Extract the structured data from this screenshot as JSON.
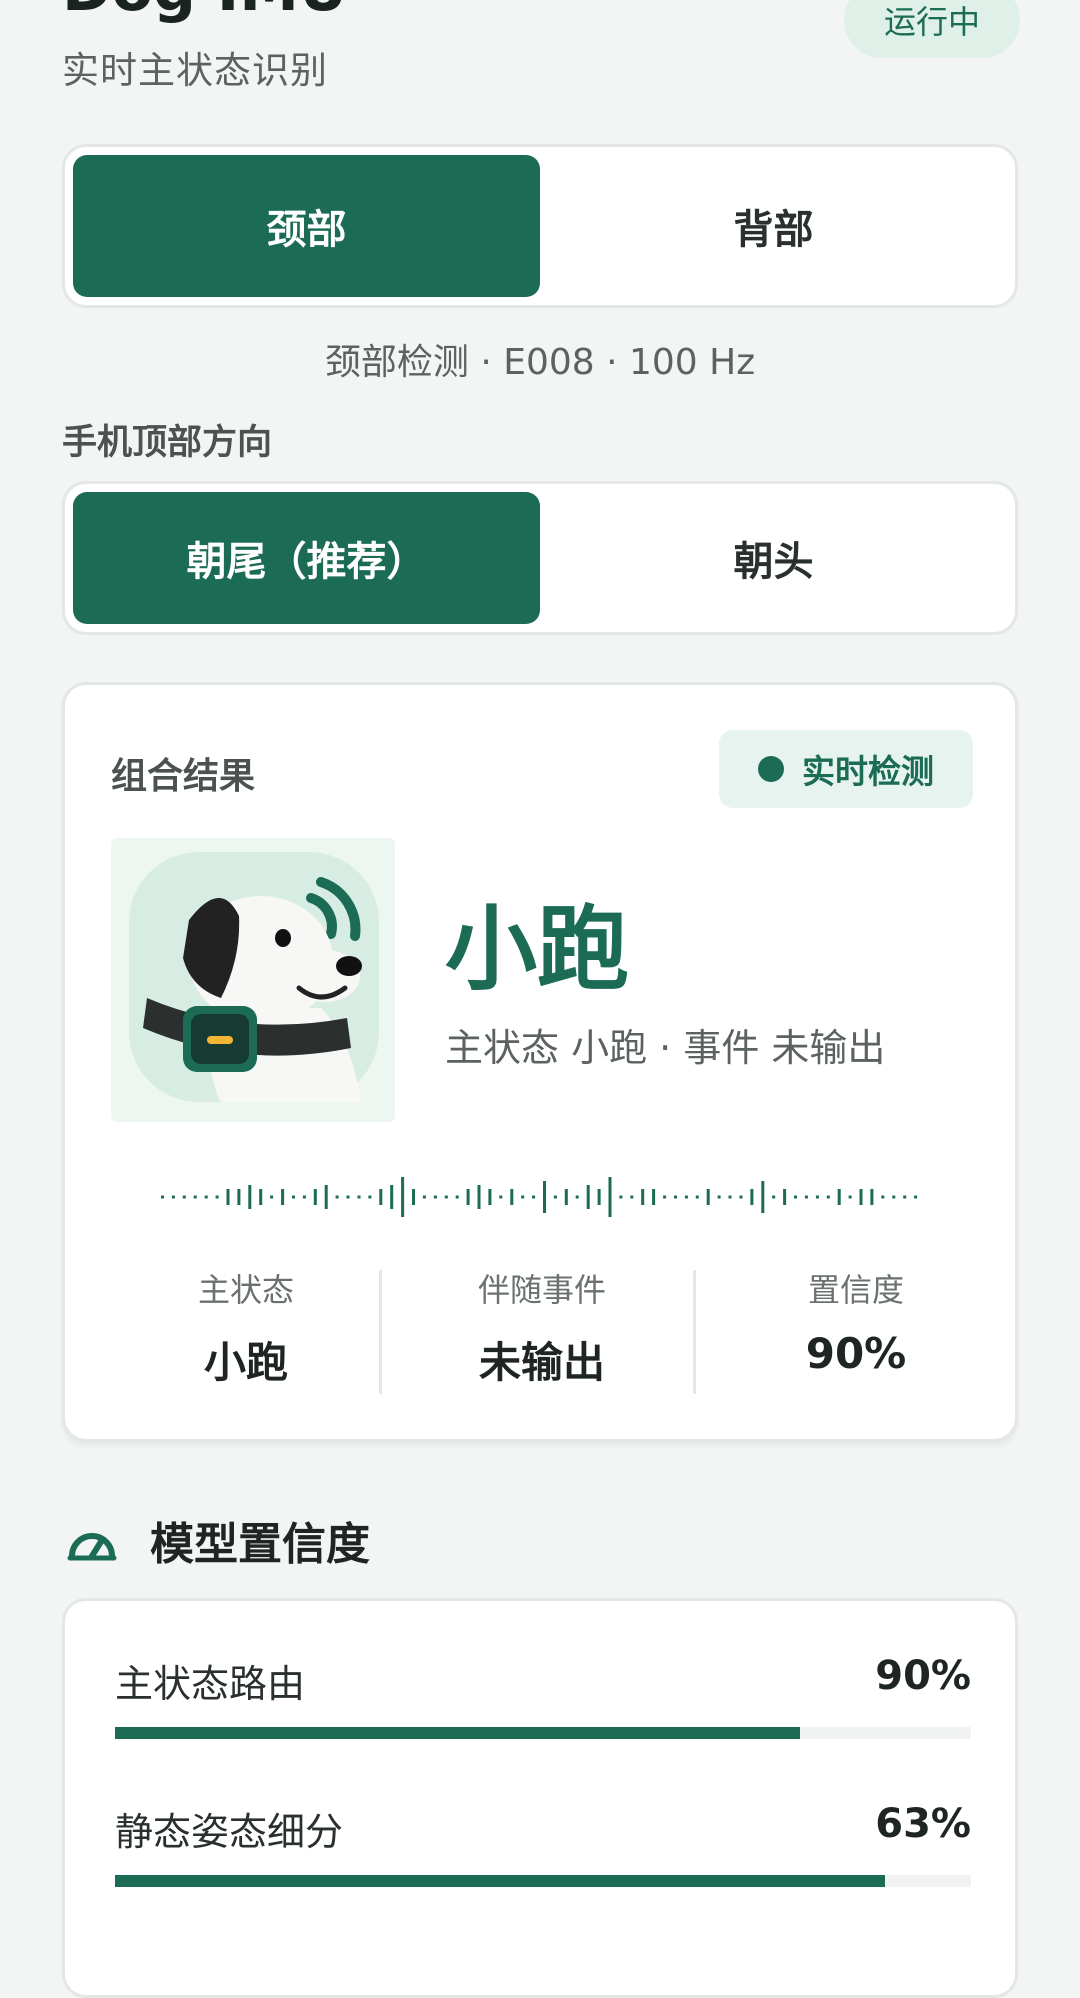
{
  "header": {
    "title": "Dog IMU",
    "subtitle": "实时主状态识别",
    "status": "运行中"
  },
  "mount": {
    "options": [
      "颈部",
      "背部"
    ],
    "selected_index": 0,
    "info": "颈部检测 · E008 · 100 Hz"
  },
  "orientation": {
    "label": "手机顶部方向",
    "options": [
      "朝尾（推荐）",
      "朝头"
    ],
    "selected_index": 0
  },
  "result": {
    "label": "组合结果",
    "badge": "实时检测",
    "state": "小跑",
    "summary": "主状态 小跑 · 事件 未输出",
    "stats": [
      {
        "label": "主状态",
        "value": "小跑"
      },
      {
        "label": "伴随事件",
        "value": "未输出"
      },
      {
        "label": "置信度",
        "value": "90%"
      }
    ]
  },
  "confidence": {
    "title": "模型置信度",
    "rows": [
      {
        "name": "主状态路由",
        "value": "90%",
        "fraction": 0.8
      },
      {
        "name": "静态姿态细分",
        "value": "63%",
        "fraction": 0.9
      }
    ]
  },
  "colors": {
    "accent": "#1b6b55",
    "accent_light": "#dff0e8",
    "background": "#f3f5f4"
  },
  "icons": {
    "dog": "dog-collar-icon",
    "gauge": "gauge-icon",
    "live": "live-dot-icon"
  }
}
